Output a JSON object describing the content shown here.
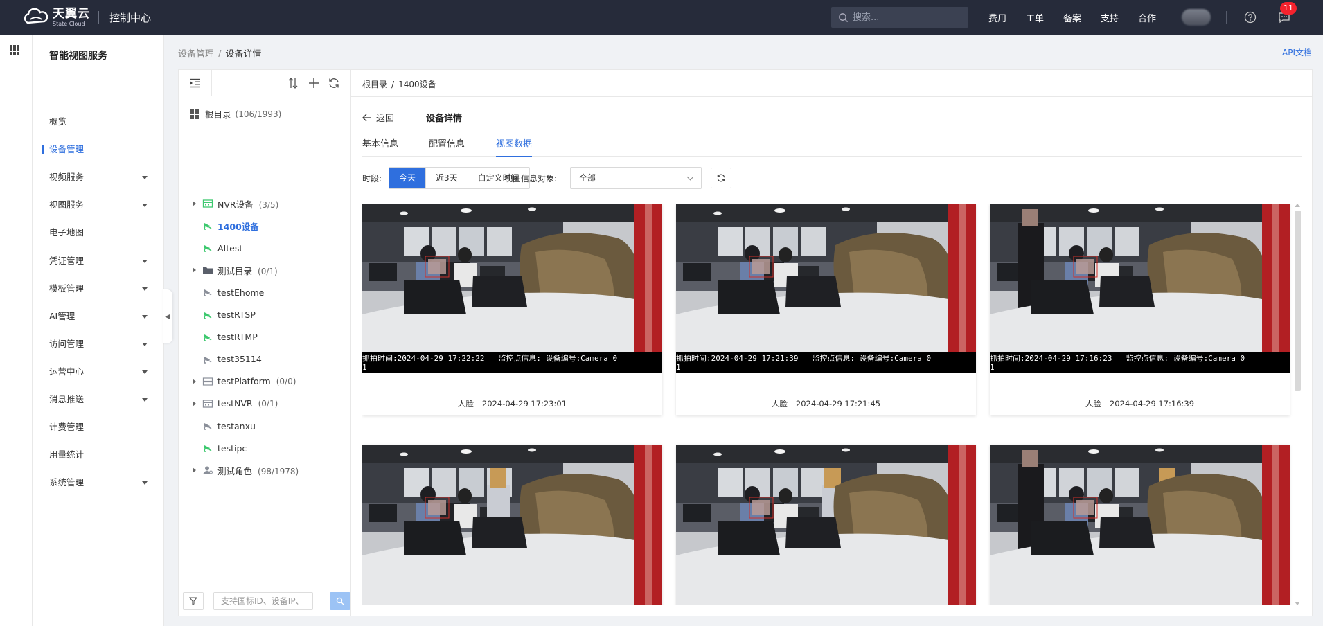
{
  "topbar": {
    "brand_cn": "天翼云",
    "brand_en": "State Cloud",
    "console": "控制中心",
    "search_placeholder": "搜索...",
    "nav": [
      "费用",
      "工单",
      "备案",
      "支持",
      "合作"
    ],
    "message_badge": "11"
  },
  "sidemenu": {
    "service_title": "智能视图服务",
    "items": [
      {
        "label": "概览",
        "caret": false,
        "active": false
      },
      {
        "label": "设备管理",
        "caret": false,
        "active": true
      },
      {
        "label": "视频服务",
        "caret": true,
        "active": false
      },
      {
        "label": "视图服务",
        "caret": true,
        "active": false
      },
      {
        "label": "电子地图",
        "caret": false,
        "active": false
      },
      {
        "label": "凭证管理",
        "caret": true,
        "active": false
      },
      {
        "label": "模板管理",
        "caret": true,
        "active": false
      },
      {
        "label": "AI管理",
        "caret": true,
        "active": false
      },
      {
        "label": "访问管理",
        "caret": true,
        "active": false
      },
      {
        "label": "运营中心",
        "caret": true,
        "active": false
      },
      {
        "label": "消息推送",
        "caret": true,
        "active": false
      },
      {
        "label": "计费管理",
        "caret": false,
        "active": false
      },
      {
        "label": "用量统计",
        "caret": false,
        "active": false
      },
      {
        "label": "系统管理",
        "caret": true,
        "active": false
      }
    ]
  },
  "breadcrumb": {
    "parent": "设备管理",
    "current": "设备详情",
    "api_doc": "API文档"
  },
  "tree": {
    "root_label": "根目录",
    "root_count": "(106/1993)",
    "nodes": [
      {
        "label": "NVR设备",
        "count": "(3/5)",
        "expandable": true,
        "icon": "nvr-device-icon",
        "online": true
      },
      {
        "label": "1400设备",
        "count": "",
        "expandable": false,
        "icon": "camera-icon",
        "online": true,
        "selected": true
      },
      {
        "label": "AItest",
        "count": "",
        "expandable": false,
        "icon": "camera-icon",
        "online": true
      },
      {
        "label": "测试目录",
        "count": "(0/1)",
        "expandable": true,
        "icon": "folder-icon",
        "online": false
      },
      {
        "label": "testEhome",
        "count": "",
        "expandable": false,
        "icon": "camera-icon",
        "online": false
      },
      {
        "label": "testRTSP",
        "count": "",
        "expandable": false,
        "icon": "camera-icon",
        "online": true
      },
      {
        "label": "testRTMP",
        "count": "",
        "expandable": false,
        "icon": "camera-icon",
        "online": true
      },
      {
        "label": "test35114",
        "count": "",
        "expandable": false,
        "icon": "camera-icon",
        "online": false
      },
      {
        "label": "testPlatform",
        "count": "(0/0)",
        "expandable": true,
        "icon": "platform-icon",
        "online": false
      },
      {
        "label": "testNVR",
        "count": "(0/1)",
        "expandable": true,
        "icon": "nvr-device-icon",
        "online": false
      },
      {
        "label": "testanxu",
        "count": "",
        "expandable": false,
        "icon": "camera-icon",
        "online": false
      },
      {
        "label": "testipc",
        "count": "",
        "expandable": false,
        "icon": "camera-icon",
        "online": true
      },
      {
        "label": "测试角色",
        "count": "(98/1978)",
        "expandable": true,
        "icon": "role-icon",
        "online": false
      }
    ],
    "search_placeholder": "支持国标ID、设备IP、"
  },
  "detail": {
    "bc_root": "根目录",
    "bc_current": "1400设备",
    "back_label": "返回",
    "title": "设备详情",
    "tabs": [
      "基本信息",
      "配置信息",
      "视图数据"
    ],
    "active_tab": 2,
    "period_label": "时段:",
    "periods": [
      "今天",
      "近3天",
      "自定义时间"
    ],
    "active_period": 0,
    "object_label": "视图信息对象:",
    "object_value": "全部"
  },
  "cards": [
    {
      "type": "人脸",
      "time": "2024-04-29 17:23:01",
      "caption1": "抓拍时间:2024-04-29 17:22:22   监控点信息: 设备编号:Camera 0",
      "caption2": "1"
    },
    {
      "type": "人脸",
      "time": "2024-04-29 17:21:45",
      "caption1": "抓拍时间:2024-04-29 17:21:39   监控点信息: 设备编号:Camera 0",
      "caption2": "1"
    },
    {
      "type": "人脸",
      "time": "2024-04-29 17:16:39",
      "caption1": "抓拍时间:2024-04-29 17:16:23   监控点信息: 设备编号:Camera 0",
      "caption2": "1"
    },
    {
      "type": "",
      "time": "",
      "caption1": "",
      "caption2": ""
    },
    {
      "type": "",
      "time": "",
      "caption1": "",
      "caption2": ""
    },
    {
      "type": "",
      "time": "",
      "caption1": "",
      "caption2": ""
    }
  ],
  "colors": {
    "topbar": "#262b3a",
    "accent": "#2f6fde",
    "online_green": "#3cc86e",
    "offline_gray": "#8a8f99"
  }
}
